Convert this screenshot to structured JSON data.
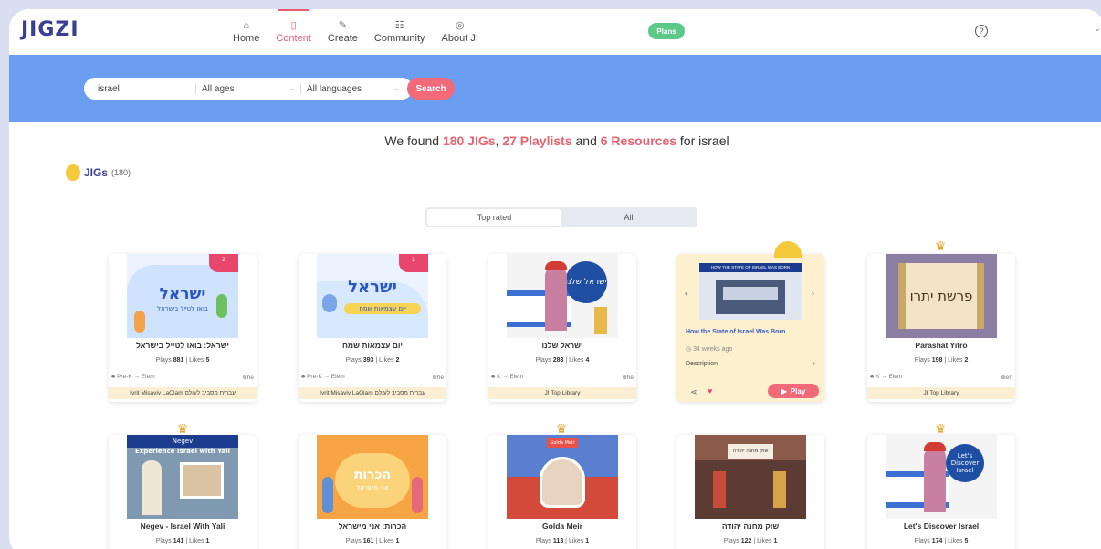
{
  "app": {
    "logo": "JIGZI"
  },
  "nav": [
    {
      "icon": "⌂",
      "label": "Home"
    },
    {
      "icon": "▯",
      "label": "Content",
      "active": true
    },
    {
      "icon": "✎",
      "label": "Create"
    },
    {
      "icon": "☷",
      "label": "Community"
    },
    {
      "icon": "◎",
      "label": "About JI"
    }
  ],
  "header": {
    "plans": "Plans",
    "help": "?"
  },
  "search": {
    "query": "israel",
    "ages": "All ages",
    "languages": "All languages",
    "button": "Search"
  },
  "results": {
    "prefix": "We found ",
    "jigs": "180 JIGs",
    "sep1": ", ",
    "playlists": "27 Playlists",
    "and": " and ",
    "resources": "6 Resources",
    "suffix": " for israel"
  },
  "jigs_section": {
    "title": "JIGs",
    "count": "(180)"
  },
  "tabs": [
    "Top rated",
    "All"
  ],
  "cards_row1": [
    {
      "title": "ישראל: בואו לטייל בישראל",
      "plays": "881",
      "likes": "5",
      "ages": "Pre-K → Elem",
      "lang": "he",
      "author": "Ivrit Misaviv LaOlam עברית מסביב לעולם",
      "thumb_text": "ישראל",
      "thumb_sub": "בואו לטייל בישראל",
      "badge": "2"
    },
    {
      "title": "יום עצמאות שמח",
      "plays": "393",
      "likes": "2",
      "ages": "Pre-K → Elem",
      "lang": "he",
      "author": "Ivrit Misaviv LaOlam עברית מסביב לעולם",
      "thumb_text": "ישראל",
      "thumb_sub": "יום עצמאות שמח",
      "badge": "2"
    },
    {
      "title": "ישראל שלנו",
      "plays": "283",
      "likes": "4",
      "ages": "K → Elem",
      "lang": "he",
      "author": "JI Top Library",
      "thumb_text": "ישראל שלנו"
    },
    {
      "title": "Parashat Yitro",
      "plays": "198",
      "likes": "2",
      "ages": "K → Elem",
      "lang": "en",
      "author": "JI Top Library",
      "thumb_text": "פרשת יתרו"
    }
  ],
  "highlight_card": {
    "title": "How the State of Israel Was Born",
    "age": "34 weeks ago",
    "desc": "Description",
    "play": "Play",
    "banner": "HOW THE STATE OF ISRAEL WAS BORN"
  },
  "cards_row2": [
    {
      "title": "Negev - Israel With Yali",
      "plays": "141",
      "likes": "1",
      "thumb_text": "Negev",
      "thumb_sub": "Experience Israel with Yali"
    },
    {
      "title": "הכרות: אני מישראל",
      "plays": "161",
      "likes": "1",
      "thumb_text": "הכרות",
      "thumb_sub": "אני מישראל"
    },
    {
      "title": "Golda Meir",
      "plays": "113",
      "likes": "1",
      "thumb_text": "Golda Meir"
    },
    {
      "title": "שוק מחנה יהודה",
      "plays": "122",
      "likes": "1",
      "thumb_text": "שוק מחנה יהודה"
    },
    {
      "title": "Let's Discover Israel",
      "plays": "174",
      "likes": "5",
      "thumb_text": "Let's Discover Israel"
    }
  ],
  "labels": {
    "plays": "Plays",
    "likes": "Likes"
  },
  "colors": {
    "accent": "#f2697a",
    "banner": "#6b9df0",
    "brand": "#3a3f93",
    "plans": "#5cc98a"
  }
}
